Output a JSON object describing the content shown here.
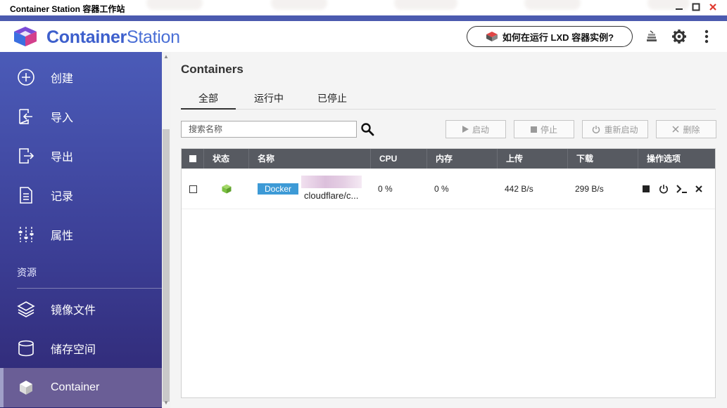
{
  "window": {
    "title": "Container Station 容器工作站",
    "controls": [
      "minimize",
      "maximize",
      "close"
    ]
  },
  "header": {
    "brand": "ContainerStation",
    "lxd_button": "如何在运行 LXD 容器实例?",
    "icons": [
      "book-stack-icon",
      "gear-icon",
      "more-vertical-icon"
    ]
  },
  "sidebar": {
    "items": [
      {
        "label": "创建",
        "icon": "plus-circle-icon"
      },
      {
        "label": "导入",
        "icon": "import-icon"
      },
      {
        "label": "导出",
        "icon": "export-icon"
      },
      {
        "label": "记录",
        "icon": "document-icon"
      },
      {
        "label": "属性",
        "icon": "sliders-icon"
      }
    ],
    "section": "资源",
    "resources": [
      {
        "label": "镜像文件",
        "icon": "layers-icon"
      },
      {
        "label": "储存空间",
        "icon": "database-icon"
      },
      {
        "label": "Container",
        "icon": "cube-icon",
        "active": true
      }
    ]
  },
  "main": {
    "title": "Containers",
    "tabs": [
      {
        "label": "全部",
        "active": true
      },
      {
        "label": "运行中",
        "active": false
      },
      {
        "label": "已停止",
        "active": false
      }
    ],
    "search_placeholder": "搜索名称",
    "actions": {
      "start": "启动",
      "stop": "停止",
      "restart": "重新启动",
      "delete": "删除"
    },
    "table": {
      "columns": {
        "status": "状态",
        "name": "名称",
        "cpu": "CPU",
        "memory": "内存",
        "upload": "上传",
        "download": "下载",
        "ops": "操作选项"
      },
      "rows": [
        {
          "type": "Docker",
          "name": "cloudflare/c...",
          "cpu": "0 %",
          "memory": "0 %",
          "upload": "442 B/s",
          "download": "299 B/s",
          "status_color": "#7cc142"
        }
      ]
    }
  },
  "colors": {
    "accent": "#4b5aaf",
    "brand_blue": "#3d5fcc",
    "docker_badge": "#3d9ad6",
    "table_header": "#575a61"
  }
}
